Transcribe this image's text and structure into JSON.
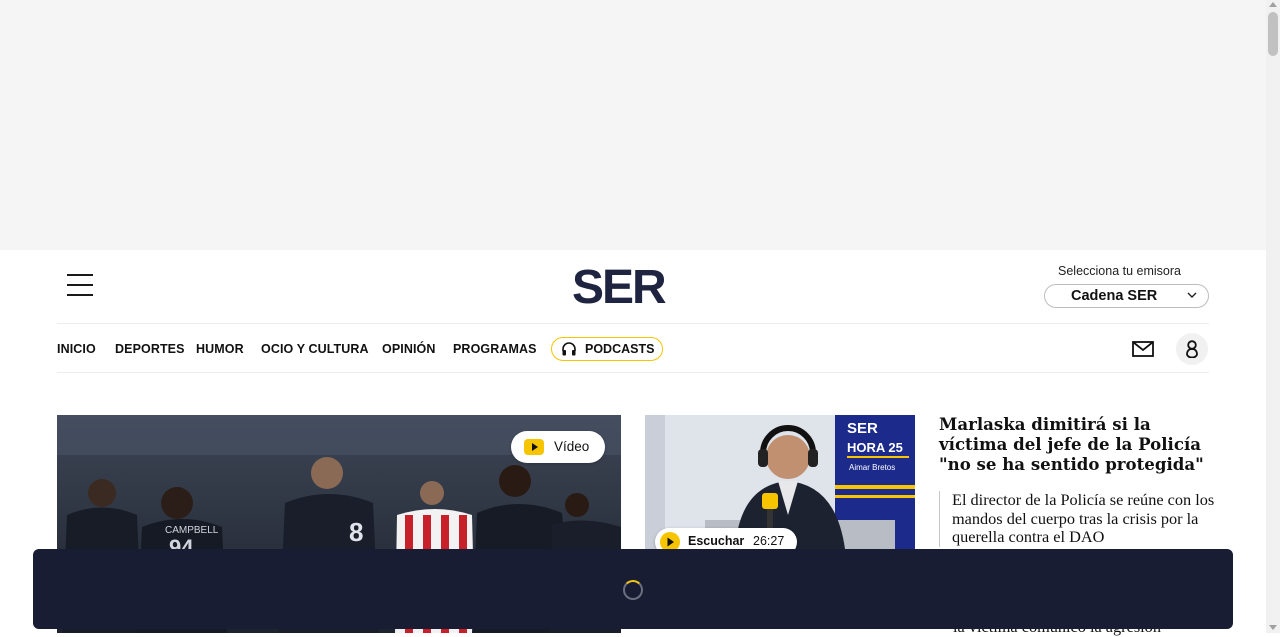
{
  "header": {
    "logo_text": "SER",
    "station_label": "Selecciona tu emisora",
    "station_value": "Cadena SER"
  },
  "nav": {
    "items": [
      {
        "label": "INICIO"
      },
      {
        "label": "DEPORTES"
      },
      {
        "label": "HUMOR"
      },
      {
        "label": "OCIO Y CULTURA"
      },
      {
        "label": "OPINIÓN"
      },
      {
        "label": "PROGRAMAS"
      }
    ],
    "podcasts_label": "PODCASTS"
  },
  "main_story": {
    "video_label": "Vídeo"
  },
  "radio_story": {
    "listen_label": "Escuchar",
    "duration": "26:27",
    "screen_brand": "SER",
    "screen_show": "HORA 25",
    "screen_host": "Aimar Bretos"
  },
  "side_story": {
    "headline": "Marlaska dimitirá si la víctima del jefe de la Policía \"no se ha sentido protegida\"",
    "related": "El director de la Policía se reúne con los mandos del cuerpo tras la crisis por la querella contra el DAO",
    "related_cut": "la víctima comunicó la agresión"
  },
  "colors": {
    "accent_yellow": "#f7c400",
    "overlay_bg": "#191d33",
    "brand_navy": "#1f2540"
  }
}
